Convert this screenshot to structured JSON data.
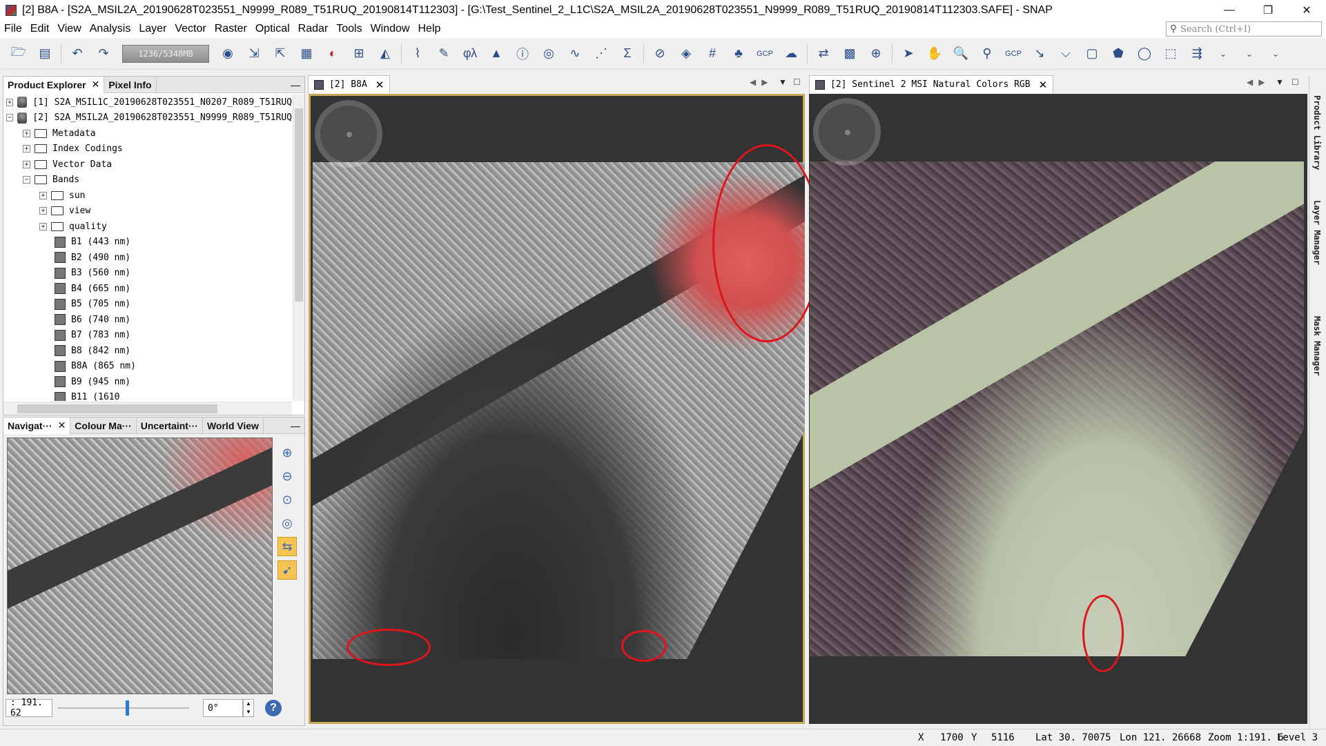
{
  "window": {
    "title": "[2] B8A - [S2A_MSIL2A_20190628T023551_N9999_R089_T51RUQ_20190814T112303] - [G:\\Test_Sentinel_2_L1C\\S2A_MSIL2A_20190628T023551_N9999_R089_T51RUQ_20190814T112303.SAFE] - SNAP",
    "minimize": "—",
    "restore": "❐",
    "close": "✕"
  },
  "menu": [
    "File",
    "Edit",
    "View",
    "Analysis",
    "Layer",
    "Vector",
    "Raster",
    "Optical",
    "Radar",
    "Tools",
    "Window",
    "Help"
  ],
  "search": {
    "placeholder": "Search (Ctrl+I)",
    "icon": "search-icon"
  },
  "toolbar": {
    "memory": "1236/5348MB",
    "icons": [
      "open-product-icon",
      "save-product-icon",
      "undo-icon",
      "redo-icon",
      "session-icon",
      "import-icon",
      "export-icon",
      "band-maths-icon",
      "rgb-icon",
      "pin-icon",
      "histogram-icon",
      "spectrum-icon",
      "statistics-icon",
      "profile-icon",
      "scatter-icon",
      "sum-icon",
      "world-map-icon",
      "graticule-icon",
      "gcp-icon",
      "pointer-icon",
      "pan-icon",
      "zoom-icon",
      "pin-placer-icon",
      "range-finder-icon",
      "rectangle-icon",
      "polygon-icon",
      "ellipse-icon",
      "magic-wand-icon"
    ]
  },
  "product_explorer": {
    "tabs": [
      {
        "label": "Product Explorer",
        "close": "✕"
      },
      {
        "label": "Pixel Info"
      }
    ],
    "minimize": "—",
    "products": [
      {
        "label": "[1]  S2A_MSIL1C_20190628T023551_N0207_R089_T51RUQ",
        "expand": "+"
      },
      {
        "label": "[2]  S2A_MSIL2A_20190628T023551_N9999_R089_T51RUQ",
        "expand": "−"
      }
    ],
    "groups": [
      {
        "label": "Metadata",
        "expand": "+"
      },
      {
        "label": "Index Codings",
        "expand": "+"
      },
      {
        "label": "Vector Data",
        "expand": "+"
      },
      {
        "label": "Bands",
        "expand": "−"
      }
    ],
    "subgroups": [
      {
        "label": "sun",
        "expand": "+"
      },
      {
        "label": "view",
        "expand": "+"
      },
      {
        "label": "quality",
        "expand": "+"
      }
    ],
    "bands": [
      "B1 (443 nm)",
      "B2 (490 nm)",
      "B3 (560 nm)",
      "B4 (665 nm)",
      "B5 (705 nm)",
      "B6 (740 nm)",
      "B7 (783 nm)",
      "B8 (842 nm)",
      "B8A (865 nm)",
      "B9 (945 nm)",
      "B11 (1610"
    ]
  },
  "navigation": {
    "tabs": [
      {
        "label": "Navigat···",
        "close": "✕"
      },
      {
        "label": "Colour Ma···"
      },
      {
        "label": "Uncertaint···"
      },
      {
        "label": "World View"
      }
    ],
    "minimize": "—",
    "zoom_value": ": 191. 62",
    "rotation": "0°",
    "spinner_up": "▲",
    "spinner_down": "▼",
    "help": "?"
  },
  "views": [
    {
      "tab_label": "[2] B8A",
      "close": "✕",
      "active": true
    },
    {
      "tab_label": "[2] Sentinel 2 MSI Natural Colors RGB",
      "close": "✕",
      "active": false
    }
  ],
  "view_controls": {
    "scroll": "◀ ▶",
    "menu": "▼",
    "maximize": "□"
  },
  "side_tabs": [
    "Product Library",
    "Layer Manager",
    "Mask Manager"
  ],
  "status": {
    "x_label": "X",
    "x_value": "1700",
    "y_label": "Y",
    "y_value": "5116",
    "lat": "Lat 30. 70075",
    "lon": "Lon 121. 26668",
    "zoom": "Zoom 1:191. 6",
    "level": "Level 3"
  },
  "colors": {
    "annotation_red": "#e0141a",
    "active_border": "#c8a850",
    "accent_blue": "#2a7ad0"
  }
}
